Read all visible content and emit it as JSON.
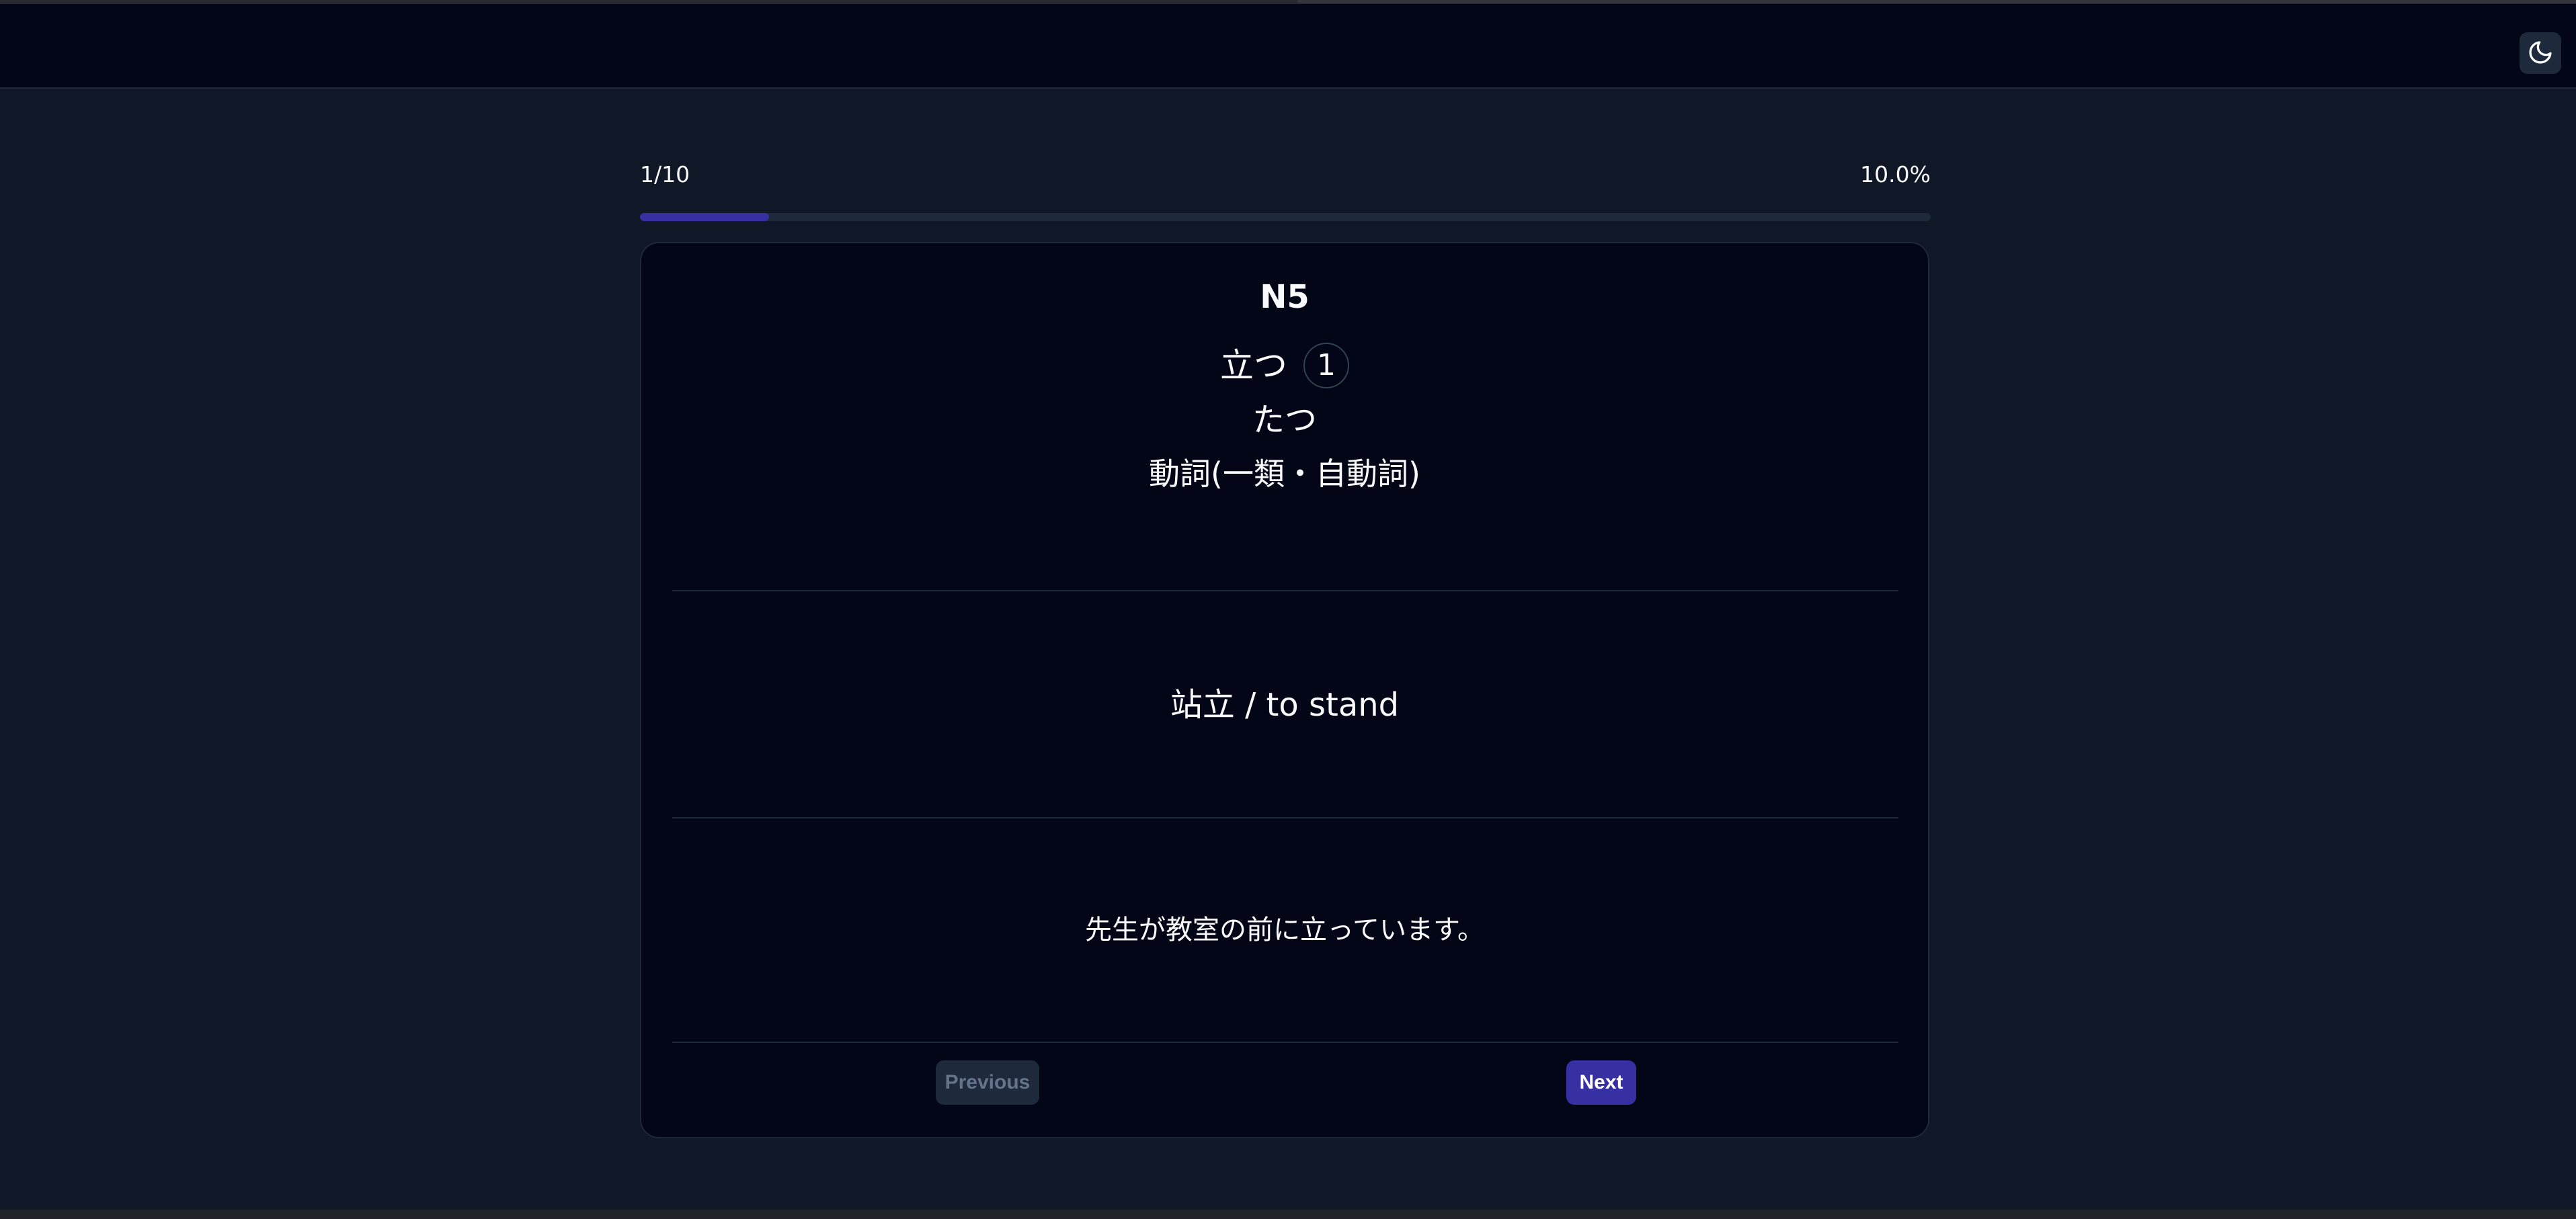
{
  "header": {
    "theme_toggle_icon": "moon-icon"
  },
  "progress": {
    "count_label": "1/10",
    "percent_label": "10.0%",
    "fraction": 0.1
  },
  "card": {
    "level": "N5",
    "word": "立つ",
    "accent": "1",
    "reading": "たつ",
    "part_of_speech": "動詞(一類・自動詞)",
    "meaning": "站立 / to stand",
    "example": "先生が教室の前に立っています。"
  },
  "nav": {
    "previous_label": "Previous",
    "next_label": "Next"
  },
  "colors": {
    "accent": "#3730a3",
    "card_background": "#020617",
    "page_background": "#101828"
  }
}
